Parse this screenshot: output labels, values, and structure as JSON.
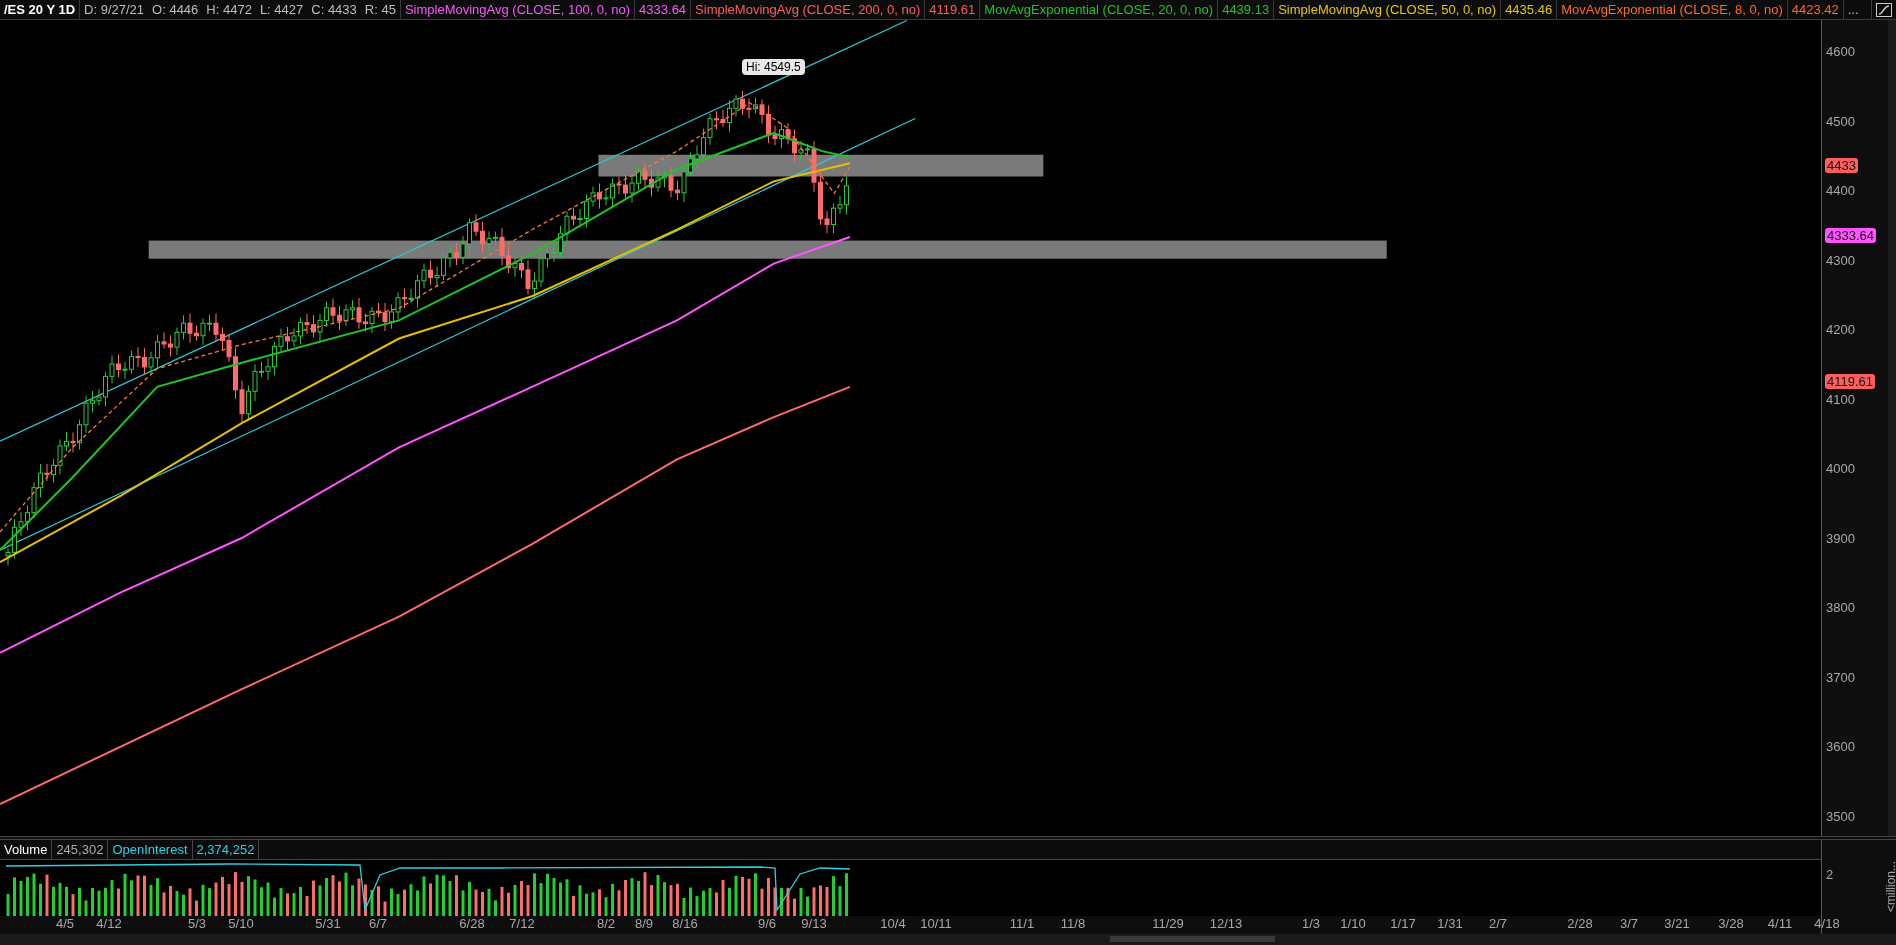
{
  "header": {
    "symbol": "/ES 20 Y 1D",
    "fields": [
      "D: 9/27/21",
      "O: 4446",
      "H: 4472",
      "L: 4427",
      "C: 4433",
      "R: 45"
    ],
    "studies": [
      {
        "name": "SimpleMovingAvg (CLOSE, 100, 0, no)",
        "value": "4333.64",
        "color": "#ff55ff"
      },
      {
        "name": "SimpleMovingAvg (CLOSE, 200, 0, no)",
        "value": "4119.61",
        "color": "#ff5b5b"
      },
      {
        "name": "MovAvgExponential (CLOSE, 20, 0, no)",
        "value": "4439.13",
        "color": "#21c421"
      },
      {
        "name": "SimpleMovingAvg (CLOSE, 50, 0, no)",
        "value": "4435.46",
        "color": "#e6c800"
      },
      {
        "name": "MovAvgExponential (CLOSE, 8, 0, no)",
        "value": "4423.42",
        "color": "#ff6a1a"
      }
    ],
    "more": "..."
  },
  "high_label": "Hi: 4549.5",
  "price_axis": {
    "ticks": [
      "4600",
      "4500",
      "4400",
      "4300",
      "4200",
      "4100",
      "4000",
      "3900",
      "3800",
      "3700",
      "3600",
      "3500"
    ],
    "badges": [
      {
        "text": "4433",
        "color": "#ff5f5f"
      },
      {
        "text": "4333.64",
        "color": "#ff55ff"
      },
      {
        "text": "4119.61",
        "color": "#ff5f5f"
      }
    ]
  },
  "volume_panel": {
    "label": "Volume",
    "volume": "245,302",
    "oi_label": "OpenInterest",
    "oi_value": "2,374,252",
    "axis_tick": "2",
    "unit": "<million..."
  },
  "date_axis": [
    "4/5",
    "4/12",
    "5/3",
    "5/10",
    "5/31",
    "6/7",
    "6/28",
    "7/12",
    "8/2",
    "8/9",
    "8/16",
    "9/6",
    "9/13",
    "10/4",
    "10/11",
    "11/1",
    "11/8",
    "11/29",
    "12/13",
    "1/3",
    "1/10",
    "1/17",
    "1/31",
    "2/7",
    "2/28",
    "3/7",
    "3/21",
    "3/28",
    "4/11",
    "4/18"
  ]
}
